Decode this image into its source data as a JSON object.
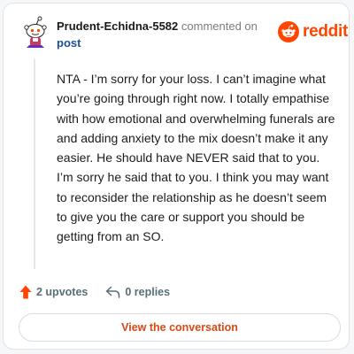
{
  "comment": {
    "author": "Prudent-Echidna-5582",
    "action_text": "commented on",
    "target_link": "post",
    "body": "NTA - I’m sorry for your loss. I can’t imagine what you’re going through right now. I totally empathise with how emotional and overwhelming funerals are and adding anxiety to the mix doesn’t make it any easier. He should have NEVER said that to you. I’m sorry he said that to you. I think you may want to reconsider the relationship as he doesn’t seem to give you the care or support you should be getting from an SO.",
    "upvotes_label": "2 upvotes",
    "replies_label": "0 replies"
  },
  "brand": {
    "name": "reddit",
    "color": "#ff4500"
  },
  "cta": {
    "label": "View the conversation"
  },
  "icons": {
    "avatar": "snoo-avatar-icon",
    "logo": "reddit-snoo-icon",
    "upvote": "upvote-arrow-icon",
    "reply": "reply-arrow-icon"
  }
}
